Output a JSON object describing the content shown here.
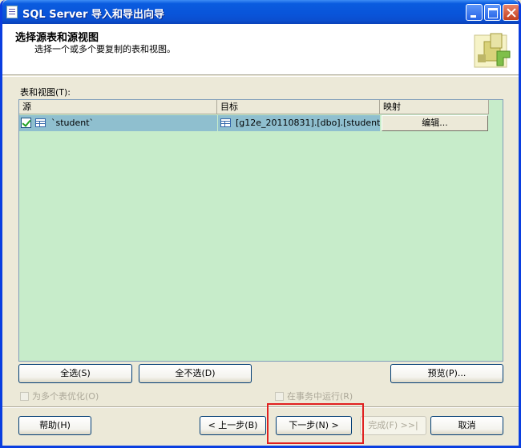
{
  "window": {
    "title": "SQL Server 导入和导出向导",
    "controls": [
      "minimize-icon",
      "maximize-icon",
      "close-icon"
    ],
    "title_bar_color": "#0a5cdf"
  },
  "header": {
    "title": "选择源表和源视图",
    "subtitle": "选择一个或多个要复制的表和视图。"
  },
  "tables_label": "表和视图(T):",
  "grid": {
    "columns": [
      "源",
      "目标",
      "映射"
    ],
    "rows": [
      {
        "checked": true,
        "source": "`student`",
        "destination": "[g12e_20110831].[dbo].[student]",
        "mapping_button": "编辑..."
      }
    ],
    "background_color": "#c7ecca",
    "selected_row_color": "#8fbfcf"
  },
  "buttons": {
    "select_all": "全选(S)",
    "deselect_all": "全不选(D)",
    "preview": "预览(P)...",
    "help": "帮助(H)",
    "back": "< 上一步(B)",
    "next": "下一步(N) >",
    "finish": "完成(F) >>|",
    "cancel": "取消"
  },
  "options": {
    "optimize_multiple": "为多个表优化(O)",
    "run_in_transaction": "在事务中运行(R)"
  },
  "highlight_color": "#e02020"
}
